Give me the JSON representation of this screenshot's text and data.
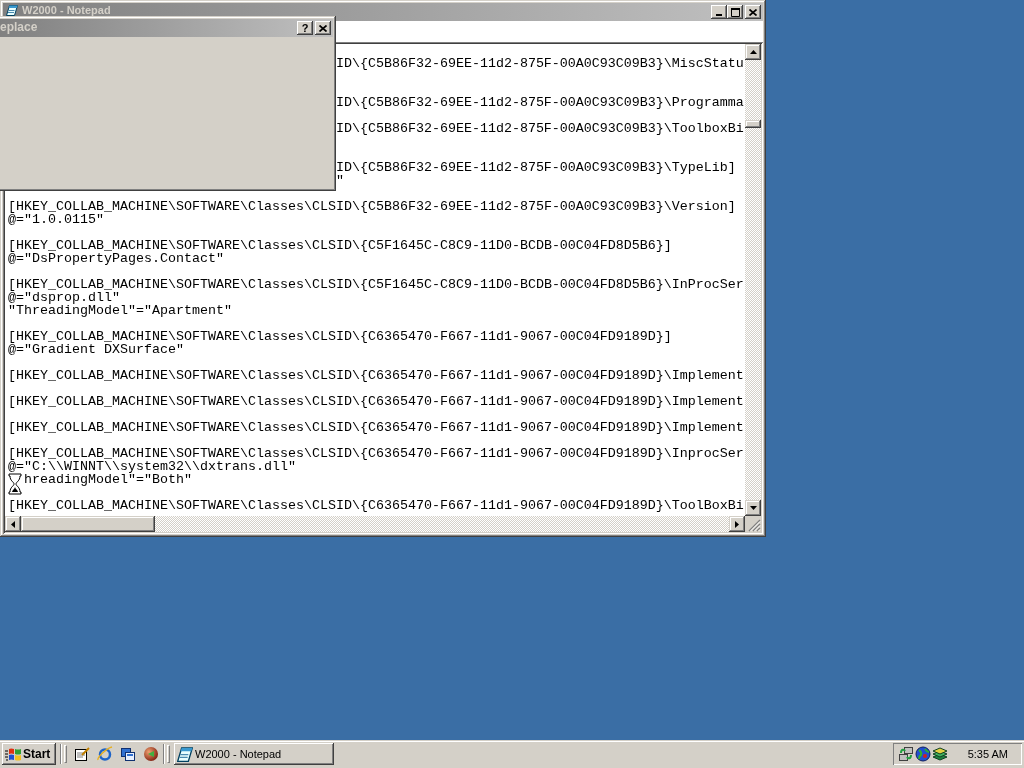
{
  "notepad": {
    "title": "W2000 - Notepad",
    "active": false
  },
  "replace_dialog": {
    "title": "eplace",
    "active": false,
    "help_button": "?"
  },
  "editor": {
    "covered_blocks": [
      {
        "kind": "key_covered_value",
        "key": "ID\\{C5B86F32-69EE-11d2-875F-00A0C93C09B3}\\MiscStatu"
      },
      {
        "kind": "key_only",
        "key": "ID\\{C5B86F32-69EE-11d2-875F-00A0C93C09B3}\\Programma"
      },
      {
        "kind": "key_covered_value",
        "key": "ID\\{C5B86F32-69EE-11d2-875F-00A0C93C09B3}\\ToolboxBi"
      },
      {
        "kind": "key_value",
        "key": "ID\\{C5B86F32-69EE-11d2-875F-00A0C93C09B3}\\TypeLib]",
        "value": "\""
      }
    ],
    "blocks": [
      {
        "lines": [
          {
            "text": "[HKEY_COLLAB_MACHINE\\SOFTWARE\\Classes\\CLSID\\{C5B86F32-69EE-11d2-875F-00A0C93C09B3}\\Version]",
            "busy_cursor": false
          },
          {
            "text": "@=\"1.0.0115\"",
            "busy_cursor": false
          }
        ]
      },
      {
        "lines": [
          {
            "text": "[HKEY_COLLAB_MACHINE\\SOFTWARE\\Classes\\CLSID\\{C5F1645C-C8C9-11D0-BCDB-00C04FD8D5B6}]",
            "busy_cursor": false
          },
          {
            "text": "@=\"DsPropertyPages.Contact\"",
            "busy_cursor": false
          }
        ]
      },
      {
        "lines": [
          {
            "text": "[HKEY_COLLAB_MACHINE\\SOFTWARE\\Classes\\CLSID\\{C5F1645C-C8C9-11D0-BCDB-00C04FD8D5B6}\\InProcSer",
            "busy_cursor": false
          },
          {
            "text": "@=\"dsprop.dll\"",
            "busy_cursor": false
          },
          {
            "text": "\"ThreadingModel\"=\"Apartment\"",
            "busy_cursor": false
          }
        ]
      },
      {
        "lines": [
          {
            "text": "[HKEY_COLLAB_MACHINE\\SOFTWARE\\Classes\\CLSID\\{C6365470-F667-11d1-9067-00C04FD9189D}]",
            "busy_cursor": false
          },
          {
            "text": "@=\"Gradient DXSurface\"",
            "busy_cursor": false
          }
        ]
      },
      {
        "lines": [
          {
            "text": "[HKEY_COLLAB_MACHINE\\SOFTWARE\\Classes\\CLSID\\{C6365470-F667-11d1-9067-00C04FD9189D}\\Implement",
            "busy_cursor": false
          }
        ]
      },
      {
        "lines": [
          {
            "text": "[HKEY_COLLAB_MACHINE\\SOFTWARE\\Classes\\CLSID\\{C6365470-F667-11d1-9067-00C04FD9189D}\\Implement",
            "busy_cursor": false
          }
        ]
      },
      {
        "lines": [
          {
            "text": "[HKEY_COLLAB_MACHINE\\SOFTWARE\\Classes\\CLSID\\{C6365470-F667-11d1-9067-00C04FD9189D}\\Implement",
            "busy_cursor": false
          }
        ]
      },
      {
        "lines": [
          {
            "text": "[HKEY_COLLAB_MACHINE\\SOFTWARE\\Classes\\CLSID\\{C6365470-F667-11d1-9067-00C04FD9189D}\\InprocSer",
            "busy_cursor": false
          },
          {
            "text": "@=\"C:\\\\WINNT\\\\system32\\\\dxtrans.dll\"",
            "busy_cursor": false
          },
          {
            "text": "hreadingModel\"=\"Both\"",
            "busy_cursor": true
          }
        ]
      },
      {
        "lines": [
          {
            "text": "[HKEY_COLLAB_MACHINE\\SOFTWARE\\Classes\\CLSID\\{C6365470-F667-11d1-9067-00C04FD9189D}\\ToolBoxBi",
            "busy_cursor": false
          }
        ]
      }
    ]
  },
  "taskbar": {
    "start_button": "Start",
    "tasks": [
      {
        "label": "W2000 - Notepad",
        "selected": false
      }
    ],
    "clock": "5:35 AM"
  }
}
